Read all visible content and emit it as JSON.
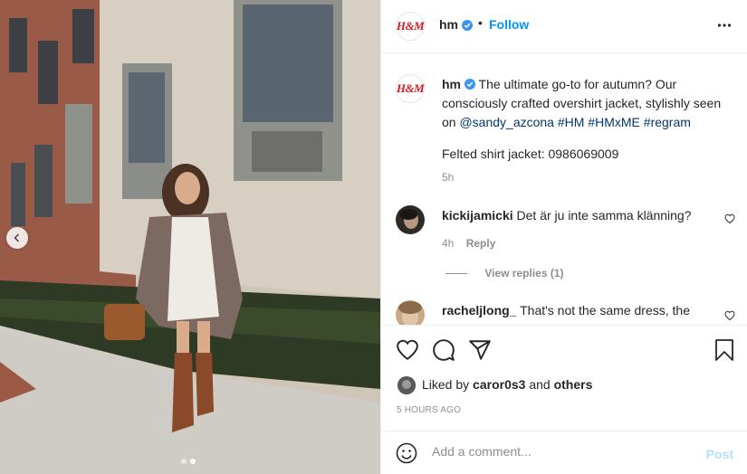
{
  "post": {
    "account": {
      "username": "hm",
      "logo_text": "H&M",
      "verified_icon": "verified-badge-icon",
      "separator": "•",
      "follow_label": "Follow"
    },
    "caption": {
      "username": "hm",
      "text_before_links": "The ultimate go-to for autumn? Our consciously crafted overshirt jacket, stylishly seen on",
      "mention": "@sandy_azcona",
      "hashtags": [
        "#HM",
        "#HMxME",
        "#regram"
      ],
      "product_line": "Felted shirt jacket: 0986069009",
      "time": "5h"
    },
    "comments": [
      {
        "username": "kickijamicki",
        "text": "Det är ju inte samma klänning?",
        "time": "4h",
        "reply_label": "Reply",
        "view_replies_label": "View replies (1)"
      },
      {
        "username": "racheljlong_",
        "text": "That's not the same dress, the"
      }
    ],
    "likes": {
      "prefix": "Liked by",
      "user": "caror0s3",
      "joiner": "and",
      "others": "others"
    },
    "timestamp": "5 HOURS AGO",
    "add_comment": {
      "placeholder": "Add a comment...",
      "post_label": "Post"
    },
    "carousel": {
      "slide_count": 2,
      "active_slide": 2
    },
    "colors": {
      "brand_red": "#d71920",
      "follow_blue": "#0095f6",
      "verified_blue": "#3897f0",
      "link_blue": "#00376b",
      "post_disabled": "#b2dffc"
    }
  }
}
